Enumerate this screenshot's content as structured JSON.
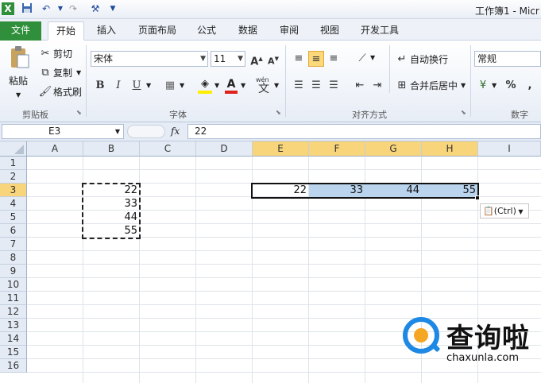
{
  "window": {
    "title": "工作簿1 - Micr"
  },
  "quick_access": [
    {
      "name": "excel-logo-icon",
      "glyph": "X"
    },
    {
      "name": "save-icon",
      "glyph": "💾"
    },
    {
      "name": "undo-icon",
      "glyph": "↶"
    },
    {
      "name": "redo-icon",
      "glyph": "↷"
    },
    {
      "name": "customize-icon",
      "glyph": "⚒"
    }
  ],
  "tabs": [
    "文件",
    "开始",
    "插入",
    "页面布局",
    "公式",
    "数据",
    "审阅",
    "视图",
    "开发工具"
  ],
  "ribbon": {
    "clipboard": {
      "paste": "粘贴",
      "cut": "剪切",
      "copy": "复制",
      "format_painter": "格式刷",
      "group": "剪贴板"
    },
    "font": {
      "name": "宋体",
      "size": "11",
      "grow": "A",
      "shrink": "A",
      "bold": "B",
      "italic": "I",
      "underline": "U",
      "phonetic": "wén",
      "group": "字体"
    },
    "alignment": {
      "wrap": "自动换行",
      "merge": "合并后居中",
      "group": "对齐方式"
    },
    "number": {
      "format": "常规",
      "percent": "%",
      "comma": ",",
      "group": "数字"
    }
  },
  "formula_bar": {
    "name_box": "E3",
    "fx": "fx",
    "value": "22"
  },
  "columns": [
    "A",
    "B",
    "C",
    "D",
    "E",
    "F",
    "G",
    "H",
    "I"
  ],
  "rows": [
    "1",
    "2",
    "3",
    "4",
    "5",
    "6",
    "7",
    "8",
    "9",
    "10",
    "11",
    "12",
    "13",
    "14",
    "15",
    "16"
  ],
  "cells": {
    "B3": "22",
    "B4": "33",
    "B5": "44",
    "B6": "55",
    "E3": "22",
    "F3": "33",
    "G3": "44",
    "H3": "55"
  },
  "paste_options": {
    "label": "(Ctrl)"
  },
  "watermark": {
    "brand": "查询啦",
    "url": "chaxunla.com"
  },
  "colors": {
    "file_tab": "#2f8f3a",
    "selection_header": "#f8d47a",
    "selection_fill": "#b9d4ec",
    "watermark_blue": "#1e88e5"
  }
}
